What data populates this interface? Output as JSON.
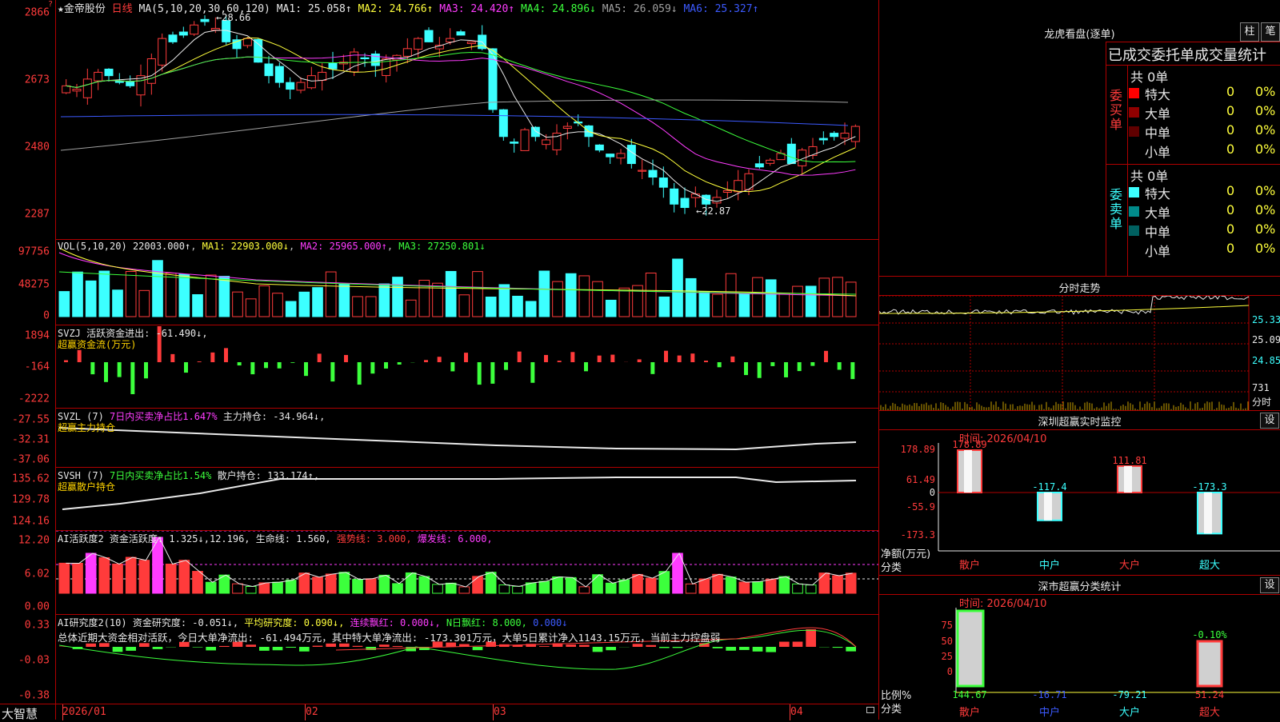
{
  "stock": {
    "name": "金帝股份",
    "period": "日线",
    "star": "★"
  },
  "kline": {
    "ma_header": "MA(5,10,20,30,60,120)",
    "ma_items": [
      {
        "label": "MA1: 25.058↑",
        "color": "#e8e8e8"
      },
      {
        "label": "MA2: 24.766↑",
        "color": "#ffff3c"
      },
      {
        "label": "MA3: 24.420↑",
        "color": "#ff3cff"
      },
      {
        "label": "MA4: 24.896↓",
        "color": "#3cff3c"
      },
      {
        "label": "MA5: 26.059↓",
        "color": "#a0a0a0"
      },
      {
        "label": "MA6: 25.327↑",
        "color": "#3c5aff"
      }
    ],
    "y_ticks": [
      "2866",
      "2673",
      "2480",
      "2287"
    ],
    "high_label": "28.66",
    "low_label": "22.87",
    "up_color": "#ff3b3b",
    "down_color": "#3cffff"
  },
  "vol": {
    "title": "VOL(5,10,20)",
    "value": "22003.000↑",
    "ma1": "MA1: 22903.000↓",
    "ma2": "MA2: 25965.000↑",
    "ma3": "MA3: 27250.801↓",
    "y_ticks": [
      "97756",
      "48275",
      "0"
    ]
  },
  "svzj": {
    "title": "SVZJ  活跃资金进出: -61.490↓,",
    "subtitle": "超赢资金流(万元)",
    "y_ticks": [
      "1894",
      "-164",
      "-2222"
    ]
  },
  "svzl": {
    "title": "SVZL (7)",
    "p1": "7日内买卖净占比1.647%",
    "p2": "主力持仓: -34.964↓,",
    "subtitle": "超赢主力持仓",
    "y_ticks": [
      "-27.55",
      "-32.31",
      "-37.06"
    ]
  },
  "svsh": {
    "title": "SVSH (7)",
    "p1": "7日内买卖净占比1.54%",
    "p2": "散户持仓: 133.174↑,",
    "subtitle": "超赢散户持仓",
    "y_ticks": [
      "135.62",
      "129.78",
      "124.16"
    ]
  },
  "huoyue": {
    "title": "AI活跃度2",
    "p1": "资金活跃度: 1.325↓,12.196,",
    "p2": "生命线: 1.560,",
    "p3": "强势线: 3.000,",
    "p4": "爆发线: 6.000,",
    "y_ticks": [
      "12.20",
      "6.02",
      "0.00"
    ]
  },
  "yanjiu": {
    "title": "AI研究度2(10)",
    "p1": "资金研究度: -0.051↓,",
    "p2": "平均研究度: 0.090↓,",
    "p3": "连续飘红: 0.000↓,",
    "p4": "N日飘红: 8.000,",
    "p5": "0.000↓",
    "summary": "总体近期大资金相对活跃，今日大单净流出: -61.494万元，其中特大单净流出: -173.301万元，大单5日累计净入1143.15万元，当前主力控盘弱",
    "y_ticks": [
      "0.33",
      "-0.03",
      "-0.38"
    ]
  },
  "xaxis": {
    "logo": "大智慧",
    "labels": [
      "2026/01",
      "02",
      "03",
      "04"
    ]
  },
  "longhu": {
    "title": "龙虎看盘(逐单)",
    "btn1": "柱",
    "btn2": "笔",
    "subtitle": "已成交委托单成交量统计",
    "buy": {
      "side": "委买单",
      "total": "共 0单",
      "rows": [
        {
          "name": "特大",
          "n": "0",
          "p": "0%",
          "color": "#ff0000"
        },
        {
          "name": "大单",
          "n": "0",
          "p": "0%",
          "color": "#900000"
        },
        {
          "name": "中单",
          "n": "0",
          "p": "0%",
          "color": "#600000"
        },
        {
          "name": "小单",
          "n": "0",
          "p": "0%",
          "color": "#000000"
        }
      ]
    },
    "sell": {
      "side": "委卖单",
      "total": "共 0单",
      "rows": [
        {
          "name": "特大",
          "n": "0",
          "p": "0%",
          "color": "#3cffff"
        },
        {
          "name": "大单",
          "n": "0",
          "p": "0%",
          "color": "#008a8a"
        },
        {
          "name": "中单",
          "n": "0",
          "p": "0%",
          "color": "#006060"
        },
        {
          "name": "小单",
          "n": "0",
          "p": "0%",
          "color": "#000000"
        }
      ]
    }
  },
  "fenshi": {
    "title": "分时走势",
    "y_ticks": [
      "25.33",
      "25.09",
      "24.85"
    ],
    "vol_ticks": [
      "731",
      "分时"
    ]
  },
  "monitor": {
    "title": "深圳超赢实时监控",
    "btn": "设",
    "time": "时间: 2026/04/10",
    "y_ticks": [
      "178.89",
      "61.49",
      "0",
      "-55.9",
      "-173.3"
    ],
    "ylabel1": "净额(万元)",
    "ylabel2": "分类",
    "bars": [
      {
        "label": "散户",
        "value": 178.89,
        "text": "178.89"
      },
      {
        "label": "中户",
        "value": -117.4,
        "text": "-117.4"
      },
      {
        "label": "大户",
        "value": 111.81,
        "text": "111.81"
      },
      {
        "label": "超大",
        "value": -173.3,
        "text": "-173.3"
      }
    ]
  },
  "classify": {
    "title": "深市超赢分类统计",
    "btn": "设",
    "time": "时间: 2026/04/10",
    "y_ticks": [
      "75",
      "50",
      "25",
      "0"
    ],
    "ylabel1": "比例%",
    "ylabel2": "分类",
    "bars": [
      {
        "label": "散户",
        "value": 144.67,
        "text": "144.67"
      },
      {
        "label": "中户",
        "value": -16.71,
        "text": "-16.71"
      },
      {
        "label": "大户",
        "value": -79.21,
        "text": "-79.21"
      },
      {
        "label": "超大",
        "value": 51.24,
        "text": "51.24",
        "pct": "-0.10%"
      }
    ]
  }
}
